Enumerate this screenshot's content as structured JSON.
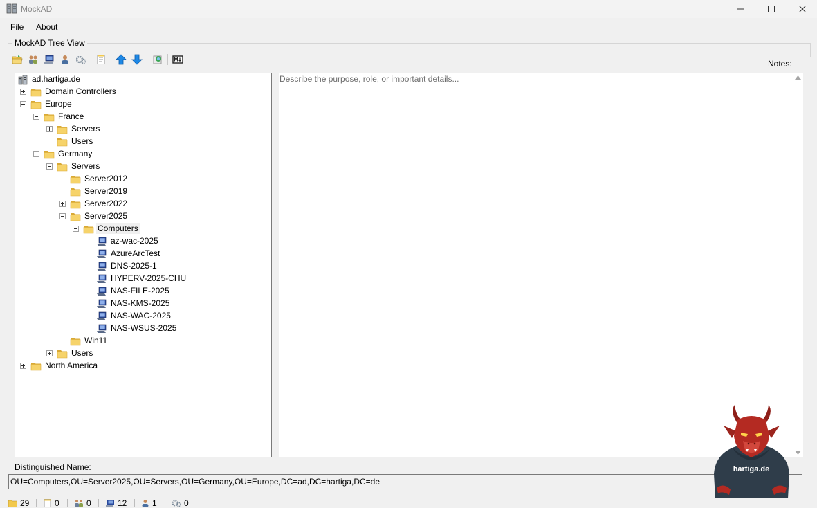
{
  "window": {
    "title": "MockAD",
    "app_icon": "server-icon"
  },
  "menu": {
    "file": "File",
    "about": "About"
  },
  "group": {
    "title": "MockAD Tree View"
  },
  "toolbar": {
    "buttons": [
      "open-folder-icon",
      "group-icon",
      "computer-icon",
      "user-icon",
      "gear-icon",
      "notes-icon",
      "arrow-up-icon",
      "arrow-down-icon",
      "refresh-icon",
      "markdown-icon"
    ]
  },
  "notes": {
    "label": "Notes:",
    "placeholder": "Describe the purpose, role, or important details..."
  },
  "tree": {
    "root": "ad.hartiga.de",
    "nodes": [
      {
        "label": "Domain Controllers",
        "type": "folder",
        "expander": "plus"
      },
      {
        "label": "Europe",
        "type": "folder",
        "expander": "minus"
      },
      {
        "label": "France",
        "type": "folder",
        "expander": "minus"
      },
      {
        "label": "Servers",
        "type": "folder",
        "expander": "plus"
      },
      {
        "label": "Users",
        "type": "folder",
        "expander": "none"
      },
      {
        "label": "Germany",
        "type": "folder",
        "expander": "minus"
      },
      {
        "label": "Servers",
        "type": "folder",
        "expander": "minus"
      },
      {
        "label": "Server2012",
        "type": "folder",
        "expander": "none"
      },
      {
        "label": "Server2019",
        "type": "folder",
        "expander": "none"
      },
      {
        "label": "Server2022",
        "type": "folder",
        "expander": "plus"
      },
      {
        "label": "Server2025",
        "type": "folder",
        "expander": "minus"
      },
      {
        "label": "Computers",
        "type": "folder",
        "expander": "minus",
        "selected": true
      },
      {
        "label": "az-wac-2025",
        "type": "computer"
      },
      {
        "label": "AzureArcTest",
        "type": "computer"
      },
      {
        "label": "DNS-2025-1",
        "type": "computer"
      },
      {
        "label": "HYPERV-2025-CHU",
        "type": "computer"
      },
      {
        "label": "NAS-FILE-2025",
        "type": "computer"
      },
      {
        "label": "NAS-KMS-2025",
        "type": "computer"
      },
      {
        "label": "NAS-WAC-2025",
        "type": "computer"
      },
      {
        "label": "NAS-WSUS-2025",
        "type": "computer"
      },
      {
        "label": "Win11",
        "type": "folder",
        "expander": "none"
      },
      {
        "label": "Users",
        "type": "folder",
        "expander": "plus"
      },
      {
        "label": "North America",
        "type": "folder",
        "expander": "plus"
      }
    ]
  },
  "dn": {
    "label": "Distinguished Name:",
    "value": "OU=Computers,OU=Server2025,OU=Servers,OU=Germany,OU=Europe,DC=ad,DC=hartiga,DC=de"
  },
  "status": {
    "ou_count": "29",
    "notes_count": "0",
    "group_count": "0",
    "computer_count": "12",
    "user_count": "1",
    "service_count": "0"
  },
  "mascot": {
    "text": "hartiga.de"
  },
  "colors": {
    "folder": "#f6d36a",
    "folder_dark": "#d9a935",
    "computer_blue": "#2a4a9c",
    "arrow_blue": "#1e88e5",
    "dragon_red": "#b42a22",
    "hoodie": "#2f3d4a"
  }
}
